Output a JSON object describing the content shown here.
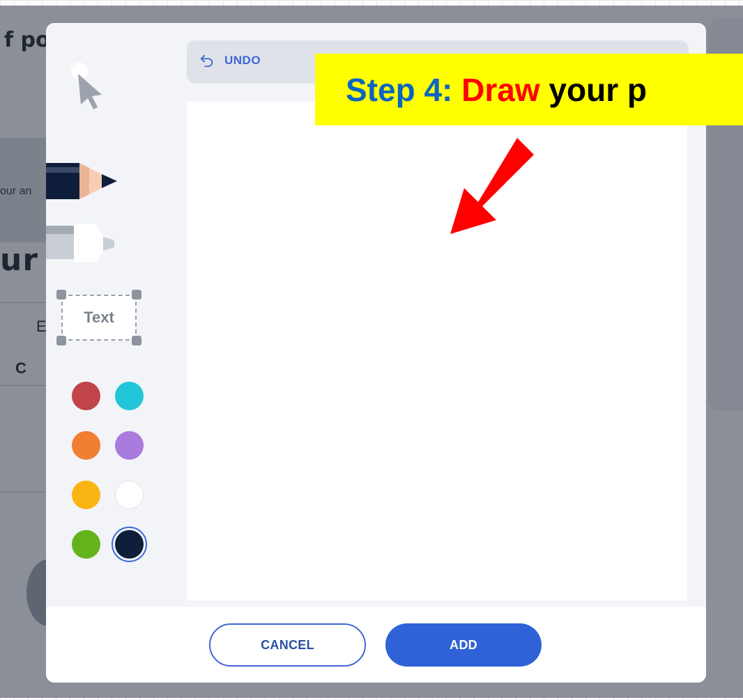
{
  "background_page": {
    "title_fragment": "f por",
    "answer_fragment": "our an",
    "heading_fragment": "ur s",
    "table_fragment_b": "E",
    "table_fragment_c": "C"
  },
  "modal": {
    "undo_label": "UNDO",
    "tools": {
      "pointer": "pointer-tool",
      "pencil": "pencil-tool",
      "marker": "marker-tool",
      "text_label": "Text"
    },
    "colors": [
      {
        "name": "red",
        "hex": "#c0444a"
      },
      {
        "name": "cyan",
        "hex": "#22c6d8"
      },
      {
        "name": "orange",
        "hex": "#f07f31"
      },
      {
        "name": "purple",
        "hex": "#a97bdc"
      },
      {
        "name": "yellow",
        "hex": "#fbb512"
      },
      {
        "name": "white",
        "hex": "#ffffff"
      },
      {
        "name": "green",
        "hex": "#64b31c"
      },
      {
        "name": "navy",
        "hex": "#0f1e3a",
        "selected": true
      }
    ],
    "cancel_label": "CANCEL",
    "add_label": "ADD"
  },
  "overlay": {
    "step_prefix": "Step 4:",
    "step_action": "Draw",
    "step_rest": "your p"
  }
}
